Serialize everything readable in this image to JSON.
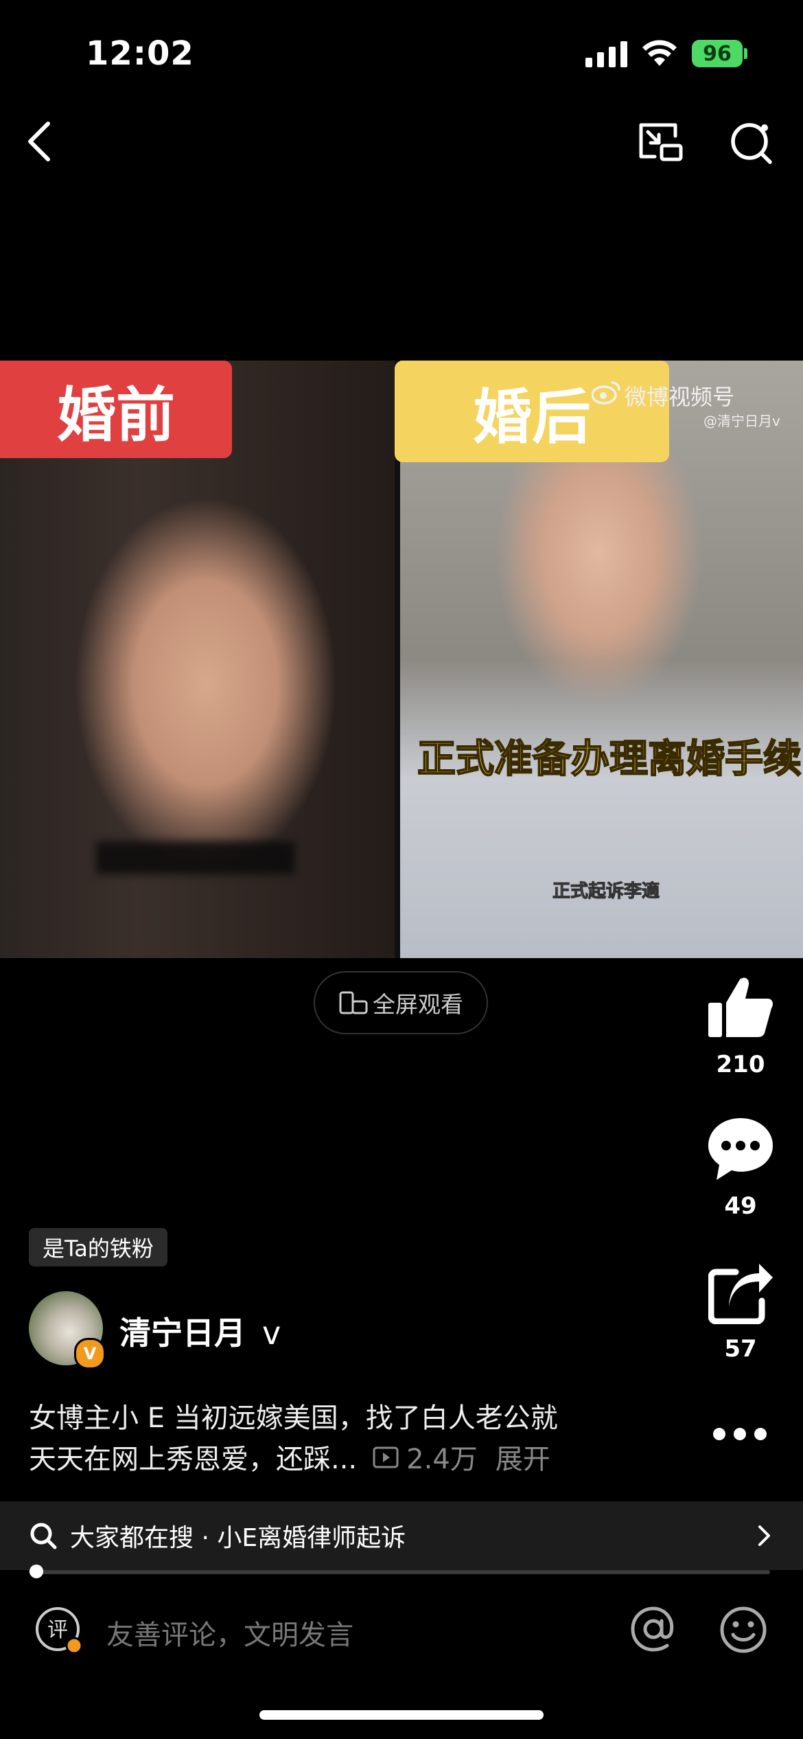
{
  "status_bar": {
    "time": "12:02",
    "battery": "96"
  },
  "video": {
    "label_before": "婚前",
    "label_after": "婚后",
    "watermark": "微博视频号",
    "watermark_handle": "@清宁日月v",
    "caption_big": "正式准备办理离婚手续",
    "caption_small": "正式起诉李適"
  },
  "fullscreen_label": "全屏观看",
  "actions": {
    "likes": "210",
    "comments": "49",
    "shares": "57"
  },
  "fan_tag": "是Ta的铁粉",
  "author": {
    "name": "清宁日月",
    "verified_suffix": "v",
    "badge": "V"
  },
  "description": {
    "line1": "女博主小 E 当初远嫁美国，找了白人老公就",
    "line2": "天天在网上秀恩爱，还踩...",
    "views": "2.4万",
    "expand": "展开"
  },
  "search_bar": {
    "text": "大家都在搜 · 小E离婚律师起诉"
  },
  "progress": 0.01,
  "comment_bar": {
    "badge": "评",
    "placeholder": "友善评论，文明发言"
  }
}
